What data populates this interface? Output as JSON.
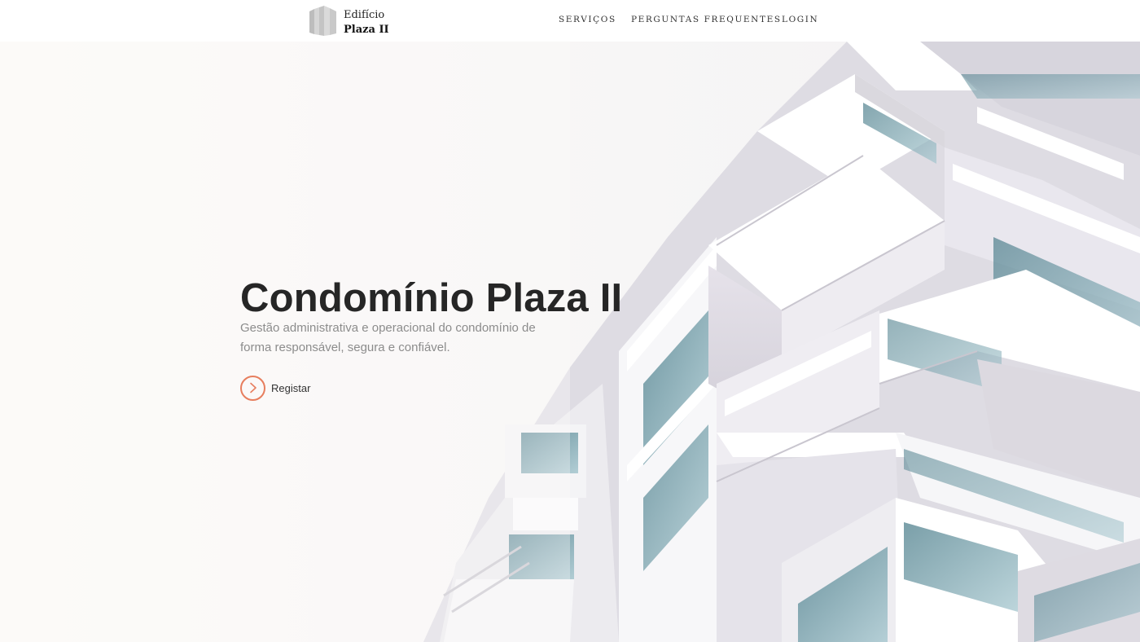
{
  "brand": {
    "line1": "Edifício",
    "line2": "Plaza II",
    "icon": "building-logo-icon"
  },
  "nav": {
    "items": [
      {
        "label": "SERVIÇOS"
      },
      {
        "label": "PERGUNTAS FREQUENTES"
      },
      {
        "label": "LOGIN"
      }
    ]
  },
  "hero": {
    "title": "Condomínio Plaza II",
    "subtitle": "Gestão administrativa e operacional do condomínio de forma responsável, segura e confiável.",
    "cta_label": "Registar",
    "cta_icon": "chevron-right-icon",
    "image": "modern-apartment-building-photo"
  },
  "colors": {
    "accent": "#e77e5e",
    "title": "#262626",
    "subtitle": "#8c8c8c",
    "glass": "#6f9fab"
  }
}
